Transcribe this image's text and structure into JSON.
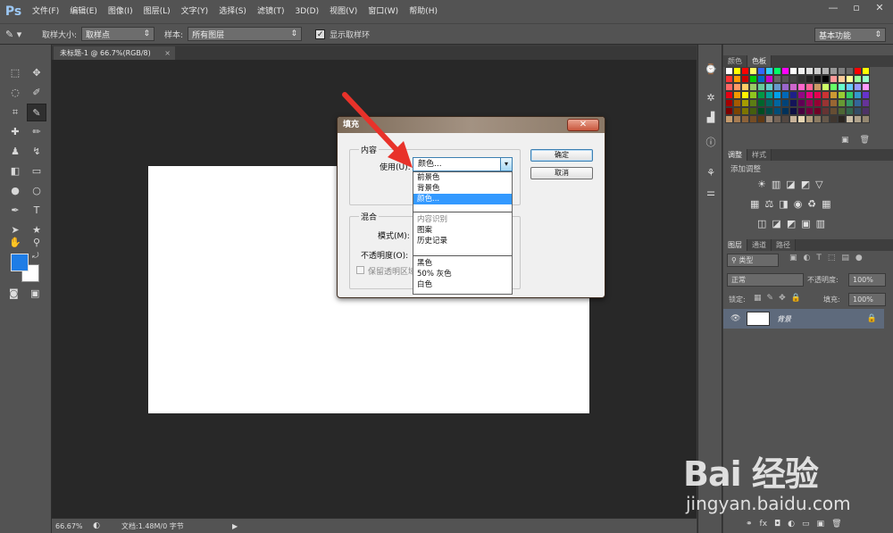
{
  "app": {
    "logo": "Ps"
  },
  "menu": [
    "文件(F)",
    "编辑(E)",
    "图像(I)",
    "图层(L)",
    "文字(Y)",
    "选择(S)",
    "滤镜(T)",
    "3D(D)",
    "视图(V)",
    "窗口(W)",
    "帮助(H)"
  ],
  "window_controls": {
    "minimize": "—",
    "maximize": "▫",
    "close": "✕"
  },
  "options_bar": {
    "sample_size_label": "取样大小:",
    "sample_size_value": "取样点",
    "sample_label": "样本:",
    "sample_value": "所有图层",
    "show_ring_label": "显示取样环",
    "show_ring_checked": true,
    "workspace": "基本功能"
  },
  "document": {
    "tab_title": "未标题-1 @ 66.7%(RGB/8)",
    "tab_close": "×"
  },
  "status": {
    "zoom": "66.67%",
    "doc_info": "文档:1.48M/0 字节"
  },
  "panels": {
    "swatches_tabs": [
      "颜色",
      "色板"
    ],
    "adjust_tabs": [
      "调整",
      "样式"
    ],
    "adjust_add": "添加调整",
    "layers_tabs": [
      "图层",
      "通道",
      "路径"
    ],
    "layer_filter": "类型",
    "blend_mode": "正常",
    "opacity_label": "不透明度:",
    "opacity_value": "100%",
    "lock_label": "锁定:",
    "fill_label": "填充:",
    "fill_value": "100%",
    "layer_name": "背景"
  },
  "swatch_colors": [
    "#ffffff",
    "#ffff00",
    "#ff0000",
    "#ffff66",
    "#3366ff",
    "#33ccff",
    "#00ff66",
    "#ff00ff",
    "#ffffff",
    "#f0f0f0",
    "#e0e0e0",
    "#cccccc",
    "#b3b3b3",
    "#999999",
    "#808080",
    "#666666",
    "#ff0000",
    "#ffff00",
    "#ff3333",
    "#ff9900",
    "#cc0000",
    "#00cc00",
    "#0066cc",
    "#cc00cc",
    "#666666",
    "#555555",
    "#444444",
    "#333333",
    "#222222",
    "#111111",
    "#000000",
    "#ff9999",
    "#ffcc99",
    "#ffff99",
    "#99ff99",
    "#99ffcc",
    "#ff6666",
    "#ff9966",
    "#ffcc66",
    "#99cc66",
    "#66cc99",
    "#66cccc",
    "#6699cc",
    "#9966cc",
    "#cc66cc",
    "#ff66cc",
    "#ff6699",
    "#cc9966",
    "#ccff66",
    "#66ff66",
    "#66ffcc",
    "#66ccff",
    "#9999ff",
    "#ff99ff",
    "#e60012",
    "#f39800",
    "#fff100",
    "#8fc31f",
    "#009944",
    "#009e96",
    "#00a0e9",
    "#0068b7",
    "#1d2088",
    "#920783",
    "#e4007f",
    "#e5004f",
    "#cc3333",
    "#cc9933",
    "#99cc33",
    "#33cc66",
    "#3399cc",
    "#6633cc",
    "#a40000",
    "#a65a00",
    "#a69c00",
    "#5c7d14",
    "#00642c",
    "#00645f",
    "#0066a0",
    "#004378",
    "#131458",
    "#5f0054",
    "#960052",
    "#950033",
    "#993333",
    "#996633",
    "#669933",
    "#339966",
    "#336699",
    "#663399",
    "#7d0000",
    "#7d4400",
    "#7d7500",
    "#455e0f",
    "#004b21",
    "#004b47",
    "#004d78",
    "#00325a",
    "#0e0f42",
    "#47003f",
    "#71003e",
    "#700026",
    "#663333",
    "#664d33",
    "#4d6633",
    "#33664d",
    "#334d66",
    "#4d3366",
    "#c69c6d",
    "#a67c52",
    "#8c6239",
    "#754c24",
    "#603913",
    "#998675",
    "#736357",
    "#534741",
    "#c7b299",
    "#e8d6b3",
    "#b39e7d",
    "#8c7b62",
    "#66584a",
    "#403730",
    "#2b2520",
    "#ccbfa8",
    "#b0a38c",
    "#948770"
  ],
  "dialog": {
    "title": "填充",
    "close": "✕",
    "content_group": "内容",
    "use_label": "使用(U):",
    "use_value": "颜色...",
    "combo_arrow": "▾",
    "blend_group": "混合",
    "mode_label": "模式(M):",
    "opacity_label": "不透明度(O):",
    "preserve_label": "保留透明区域",
    "ok": "确定",
    "cancel": "取消"
  },
  "dropdown": {
    "group1": [
      "前景色",
      "背景色",
      "颜色..."
    ],
    "selected_index": 2,
    "group2": [
      "内容识别",
      "图案",
      "历史记录"
    ],
    "group2_disabled_index": 0,
    "group3": [
      "黑色",
      "50% 灰色",
      "白色"
    ]
  },
  "watermark": {
    "brand": "Bai 经验",
    "url": "jingyan.baidu.com"
  }
}
